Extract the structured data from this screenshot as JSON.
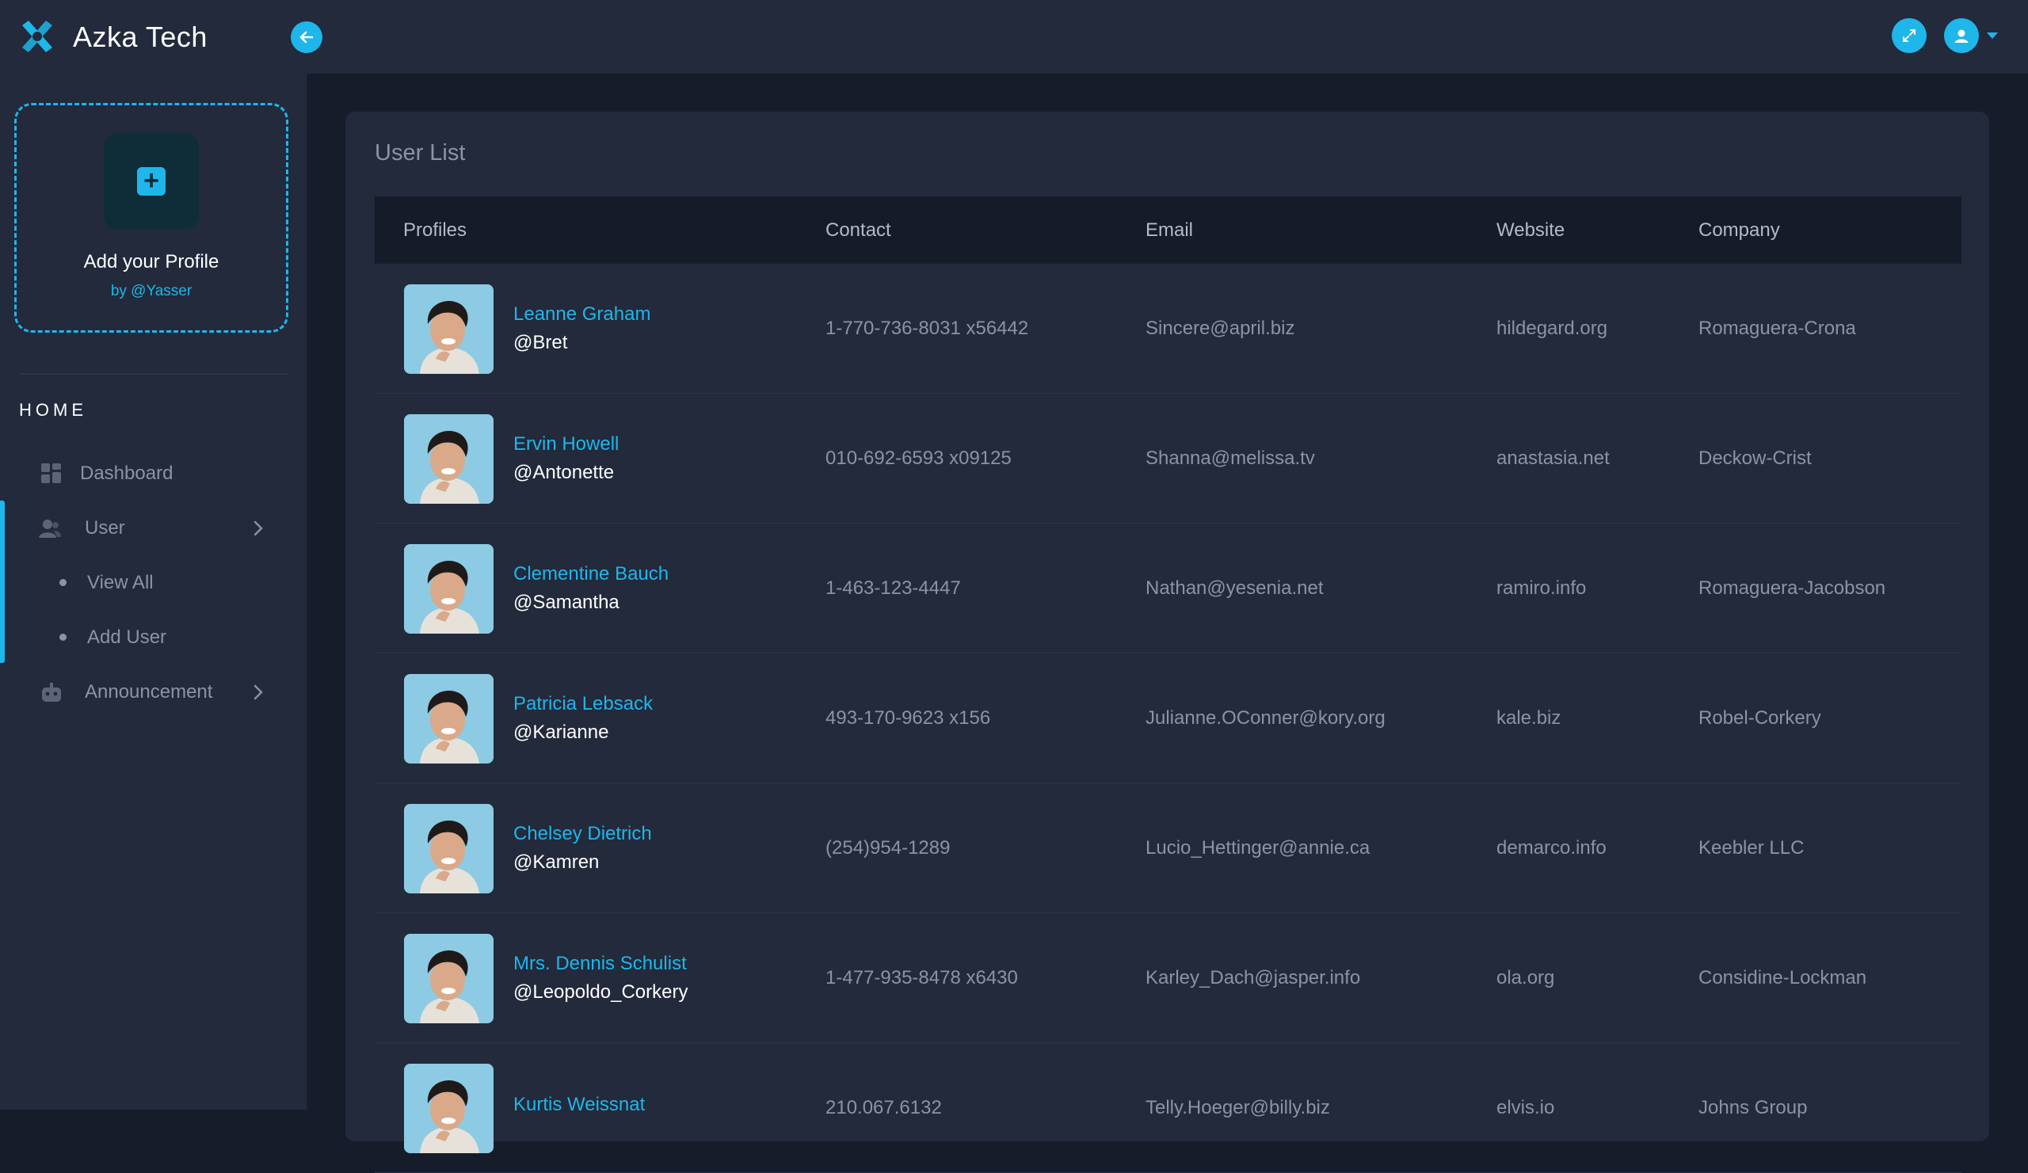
{
  "app": {
    "brand_name": "Azka Tech",
    "accent_color": "#1fb6ea"
  },
  "sidebar": {
    "profile_card": {
      "title": "Add your Profile",
      "by": "by @Yasser",
      "add_icon": "plus-icon"
    },
    "section_title": "HOME",
    "items": [
      {
        "label": "Dashboard",
        "icon": "dashboard-grid-icon"
      },
      {
        "label": "User",
        "icon": "users-icon",
        "expanded": true,
        "children": [
          {
            "label": "View All"
          },
          {
            "label": "Add User"
          }
        ]
      },
      {
        "label": "Announcement",
        "icon": "robot-icon"
      }
    ]
  },
  "main": {
    "title": "User List",
    "columns": [
      "Profiles",
      "Contact",
      "Email",
      "Website",
      "Company"
    ],
    "rows": [
      {
        "name": "Leanne Graham",
        "handle": "@Bret",
        "contact": "1-770-736-8031 x56442",
        "email": "Sincere@april.biz",
        "website": "hildegard.org",
        "company": "Romaguera-Crona"
      },
      {
        "name": "Ervin Howell",
        "handle": "@Antonette",
        "contact": "010-692-6593 x09125",
        "email": "Shanna@melissa.tv",
        "website": "anastasia.net",
        "company": "Deckow-Crist"
      },
      {
        "name": "Clementine Bauch",
        "handle": "@Samantha",
        "contact": "1-463-123-4447",
        "email": "Nathan@yesenia.net",
        "website": "ramiro.info",
        "company": "Romaguera-Jacobson"
      },
      {
        "name": "Patricia Lebsack",
        "handle": "@Karianne",
        "contact": "493-170-9623 x156",
        "email": "Julianne.OConner@kory.org",
        "website": "kale.biz",
        "company": "Robel-Corkery"
      },
      {
        "name": "Chelsey Dietrich",
        "handle": "@Kamren",
        "contact": "(254)954-1289",
        "email": "Lucio_Hettinger@annie.ca",
        "website": "demarco.info",
        "company": "Keebler LLC"
      },
      {
        "name": "Mrs. Dennis Schulist",
        "handle": "@Leopoldo_Corkery",
        "contact": "1-477-935-8478 x6430",
        "email": "Karley_Dach@jasper.info",
        "website": "ola.org",
        "company": "Considine-Lockman"
      },
      {
        "name": "Kurtis Weissnat",
        "handle": "",
        "contact": "210.067.6132",
        "email": "Telly.Hoeger@billy.biz",
        "website": "elvis.io",
        "company": "Johns Group"
      }
    ]
  }
}
